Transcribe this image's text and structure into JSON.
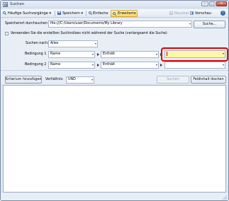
{
  "window": {
    "title": "Suchen"
  },
  "toolbar": {
    "saved_searches": "Häufige Suchvorgänge",
    "save": "Speichern",
    "simple": "Einfache",
    "advanced": "Erweiterte",
    "results": "Resultat",
    "preview": "Vorschau",
    "help": "?"
  },
  "search_location": {
    "label": "Speicherort durchsuchen",
    "value": "file:///C:/Users/user/Documents/My Library",
    "button": "Suche..."
  },
  "exclude_option": {
    "label": "Verwenden Sie die erstellten Suchindizes nicht während der Suche (verlangsamt die Suche)"
  },
  "search_for": {
    "label": "Suchen nach:",
    "value": "Alles"
  },
  "conditions": [
    {
      "label": "Bedingung 1",
      "field": "Name",
      "operator": "Enthält",
      "value": ""
    },
    {
      "label": "Bedingung 2",
      "field": "Name",
      "operator": "Enthält",
      "value": ""
    }
  ],
  "bottom_controls": {
    "add_criteria": "Kriterium hinzufügen",
    "relation_label": "Verhältnis:",
    "relation_value": "UND",
    "search_button": "Suchen",
    "clear_button": "Feldinhalt löschen"
  },
  "colors": {
    "highlight_ring": "#e00000",
    "active_field": "#fff6a8",
    "active_tab": "#ffd860"
  }
}
